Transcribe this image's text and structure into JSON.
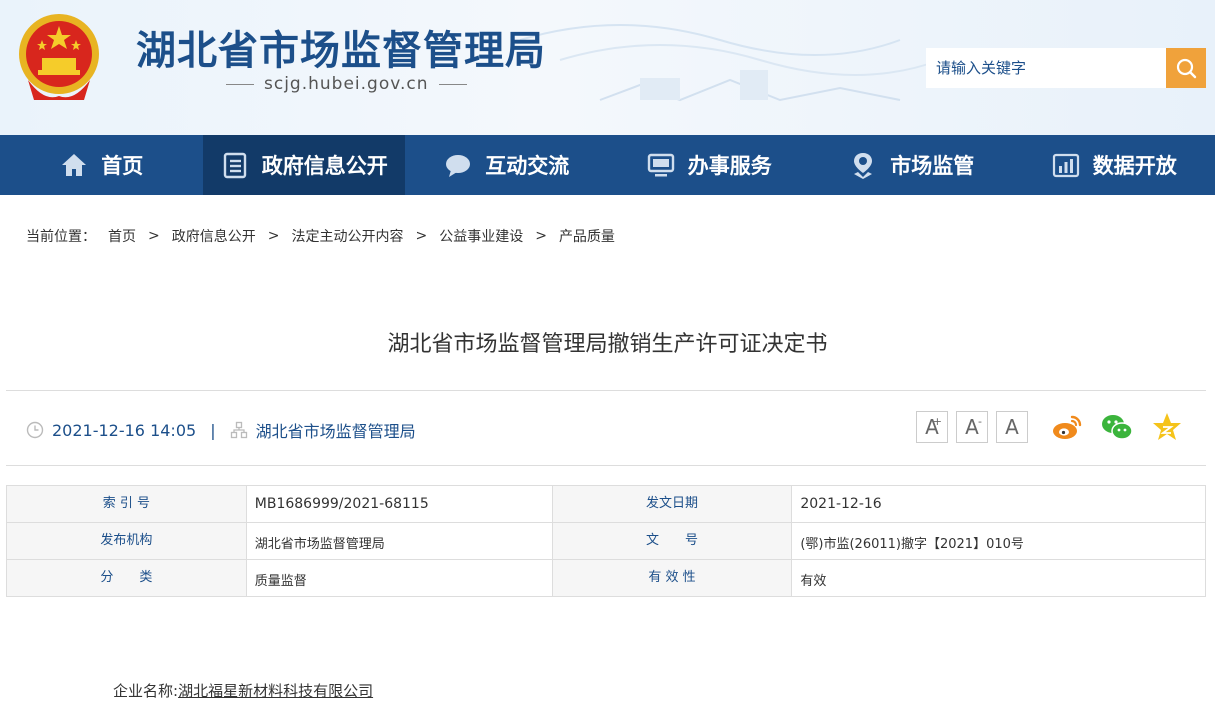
{
  "header": {
    "site_title": "湖北省市场监督管理局",
    "site_url": "scjg.hubei.gov.cn",
    "search_placeholder": "请输入关键字"
  },
  "nav": {
    "items": [
      {
        "label": "首页",
        "icon": "home-icon"
      },
      {
        "label": "政府信息公开",
        "icon": "document-list-icon",
        "active": true
      },
      {
        "label": "互动交流",
        "icon": "chat-bubble-icon"
      },
      {
        "label": "办事服务",
        "icon": "monitor-icon"
      },
      {
        "label": "市场监管",
        "icon": "location-pin-icon"
      },
      {
        "label": "数据开放",
        "icon": "bar-chart-icon"
      }
    ]
  },
  "breadcrumb": {
    "prefix": "当前位置：",
    "items": [
      "首页",
      "政府信息公开",
      "法定主动公开内容",
      "公益事业建设",
      "产品质量"
    ],
    "separator": ">"
  },
  "article": {
    "title": "湖北省市场监督管理局撤销生产许可证决定书",
    "datetime": "2021-12-16 14:05",
    "source": "湖北省市场监督管理局",
    "meta_separator": "|"
  },
  "font_size_buttons": [
    {
      "label": "A",
      "mark": "+"
    },
    {
      "label": "A",
      "mark": "-"
    },
    {
      "label": "A",
      "mark": ""
    }
  ],
  "share_icons": [
    "weibo-icon",
    "wechat-icon",
    "favorite-star-icon"
  ],
  "info": {
    "rows": [
      {
        "k1": "索 引 号",
        "v1": "MB1686999/2021-68115",
        "k2": "发文日期",
        "v2": "2021-12-16"
      },
      {
        "k1": "发布机构",
        "v1": "湖北省市场监督管理局",
        "k2": "文　　号",
        "v2": "(鄂)市监(26011)撤字【2021】010号"
      },
      {
        "k1": "分　　类",
        "v1": "质量监督",
        "k2": "有 效 性",
        "v2": "有效"
      }
    ]
  },
  "body": {
    "company_label": "企业名称:",
    "company_name": "湖北福星新材料科技有限公司"
  },
  "colors": {
    "brand_blue": "#1c4f8a",
    "nav_active": "#123a68",
    "search_orange": "#f0a23b",
    "weibo_orange": "#f08a1c",
    "wechat_green": "#3bb43c",
    "star_yellow": "#f5c31a"
  }
}
